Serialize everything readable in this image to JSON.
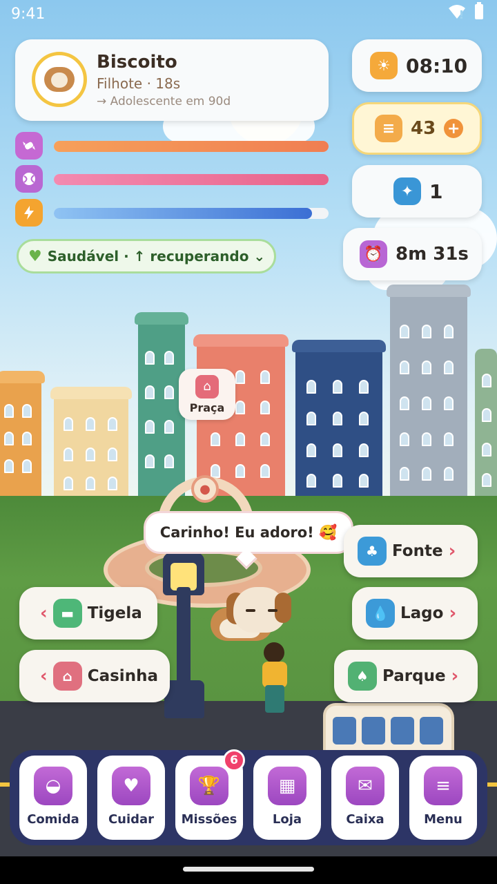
{
  "status_bar": {
    "time": "9:41"
  },
  "pet": {
    "name": "Biscoito",
    "stage": "Filhote · 18s",
    "next_stage": "→ Adolescente em 90d"
  },
  "stats": [
    {
      "name": "hunger",
      "icon": "candy-icon",
      "level": 1.0,
      "color": "#f3894f"
    },
    {
      "name": "fun",
      "icon": "ball-icon",
      "level": 1.0,
      "color": "#ee6d8a"
    },
    {
      "name": "energy",
      "icon": "lightning-icon",
      "level": 0.94,
      "color": "#3f77d6"
    }
  ],
  "health": {
    "label": "Saudável · ↑ recuperando ⌄"
  },
  "right": {
    "time": "08:10",
    "coins": "43",
    "stars": "1",
    "timer": "8m 31s"
  },
  "location": {
    "label": "Praça"
  },
  "speech": "Carinho! Eu adoro! 🥰",
  "nav": {
    "left": [
      {
        "label": "Tigela"
      },
      {
        "label": "Casinha"
      }
    ],
    "right": [
      {
        "label": "Fonte"
      },
      {
        "label": "Lago"
      },
      {
        "label": "Parque"
      }
    ]
  },
  "dock": {
    "items": [
      {
        "label": "Comida"
      },
      {
        "label": "Cuidar"
      },
      {
        "label": "Missões"
      },
      {
        "label": "Loja"
      },
      {
        "label": "Caixa"
      },
      {
        "label": "Menu"
      }
    ],
    "missions_badge": "6"
  }
}
